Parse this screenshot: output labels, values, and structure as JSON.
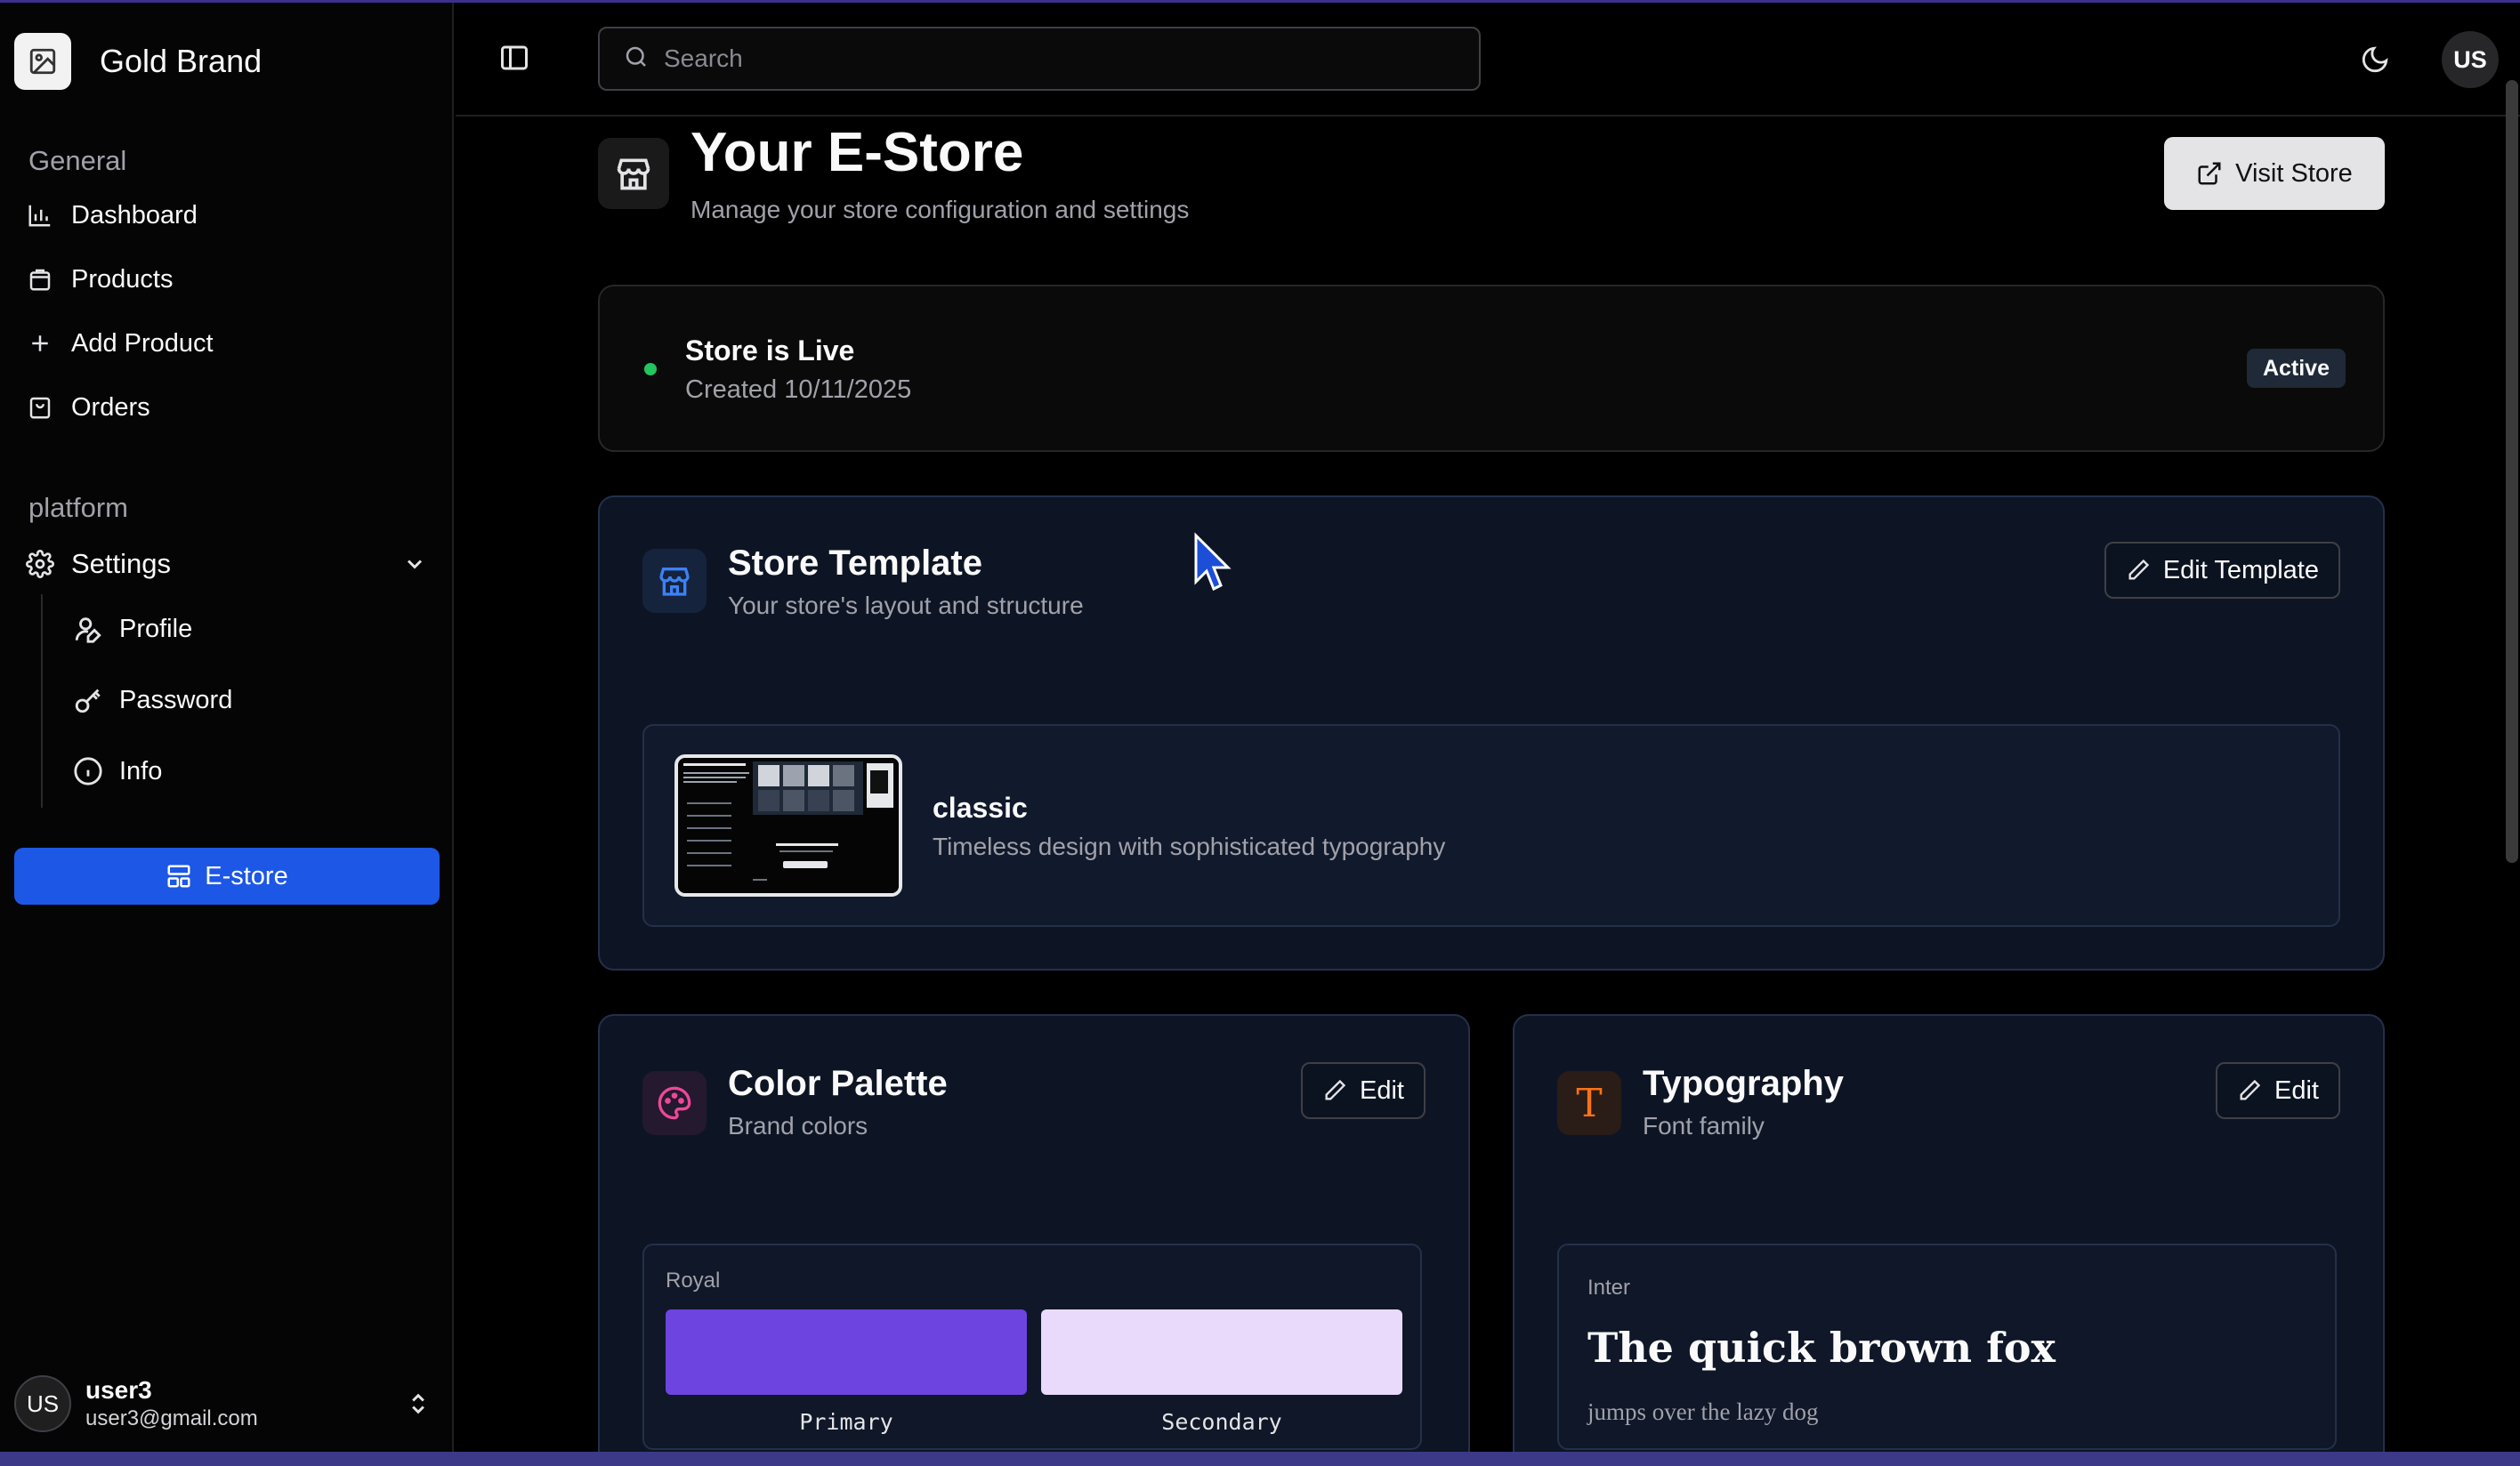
{
  "app": {
    "brand_name": "Gold Brand"
  },
  "sidebar": {
    "general_label": "General",
    "platform_label": "platform",
    "nav": [
      {
        "label": "Dashboard",
        "icon": "bar-chart-icon"
      },
      {
        "label": "Products",
        "icon": "shopping-bag-icon"
      },
      {
        "label": "Add Product",
        "icon": "plus-icon"
      },
      {
        "label": "Orders",
        "icon": "shopping-bag-icon"
      }
    ],
    "settings": {
      "label": "Settings",
      "items": [
        {
          "label": "Profile",
          "icon": "user-pen-icon"
        },
        {
          "label": "Password",
          "icon": "key-icon"
        },
        {
          "label": "Info",
          "icon": "info-icon"
        }
      ]
    },
    "estore_button": "E-store",
    "user": {
      "initials": "US",
      "name": "user3",
      "email": "user3@gmail.com"
    }
  },
  "topbar": {
    "search_placeholder": "Search",
    "avatar_initials": "US"
  },
  "page": {
    "title": "Your E-Store",
    "subtitle": "Manage your store configuration and settings",
    "visit_button": "Visit Store"
  },
  "status_card": {
    "title": "Store is Live",
    "created": "Created 10/11/2025",
    "badge": "Active",
    "dot_color": "#22c55e"
  },
  "template_card": {
    "title": "Store Template",
    "subtitle": "Your store's layout and structure",
    "edit_button": "Edit Template",
    "template_name": "classic",
    "template_desc": "Timeless design with sophisticated typography"
  },
  "palette_card": {
    "title": "Color Palette",
    "subtitle": "Brand colors",
    "edit_button": "Edit",
    "palette_name": "Royal",
    "swatches": [
      {
        "label": "Primary",
        "color": "#6d44e0"
      },
      {
        "label": "Secondary",
        "color": "#e9dafb"
      }
    ]
  },
  "typography_card": {
    "title": "Typography",
    "subtitle": "Font family",
    "edit_button": "Edit",
    "icon_letter": "T",
    "font_name": "Inter",
    "sample_heading": "The quick brown fox",
    "sample_body": "jumps over the lazy dog"
  },
  "colors": {
    "accent": "#1d57e6",
    "background": "#000000",
    "card_navy": "#0d1525",
    "palette_icon": "#ec4899",
    "typography_icon": "#f97316",
    "template_icon": "#3b82f6"
  }
}
